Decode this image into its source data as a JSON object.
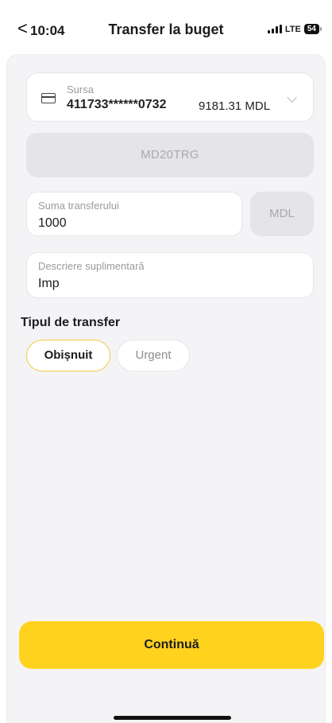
{
  "status_bar": {
    "time": "10:04",
    "network": "LTE",
    "battery": "54"
  },
  "header": {
    "back_glyph": "<",
    "title": "Transfer la buget"
  },
  "source": {
    "label": "Sursa",
    "account": "411733******0732",
    "balance": "9181.31 MDL"
  },
  "iban": {
    "value": "MD20TRG"
  },
  "amount_field": {
    "label": "Suma transferului",
    "value": "1000"
  },
  "currency": {
    "value": "MDL"
  },
  "description_field": {
    "label": "Descriere suplimentară",
    "value": "Imp"
  },
  "transfer_type": {
    "title": "Tipul de transfer",
    "options": [
      {
        "label": "Obișnuit",
        "selected": true
      },
      {
        "label": "Urgent",
        "selected": false
      }
    ]
  },
  "footer": {
    "continue_label": "Continuă"
  },
  "colors": {
    "accent": "#ffd21e",
    "selected_border": "#f0c842",
    "background": "#f4f4f6"
  }
}
